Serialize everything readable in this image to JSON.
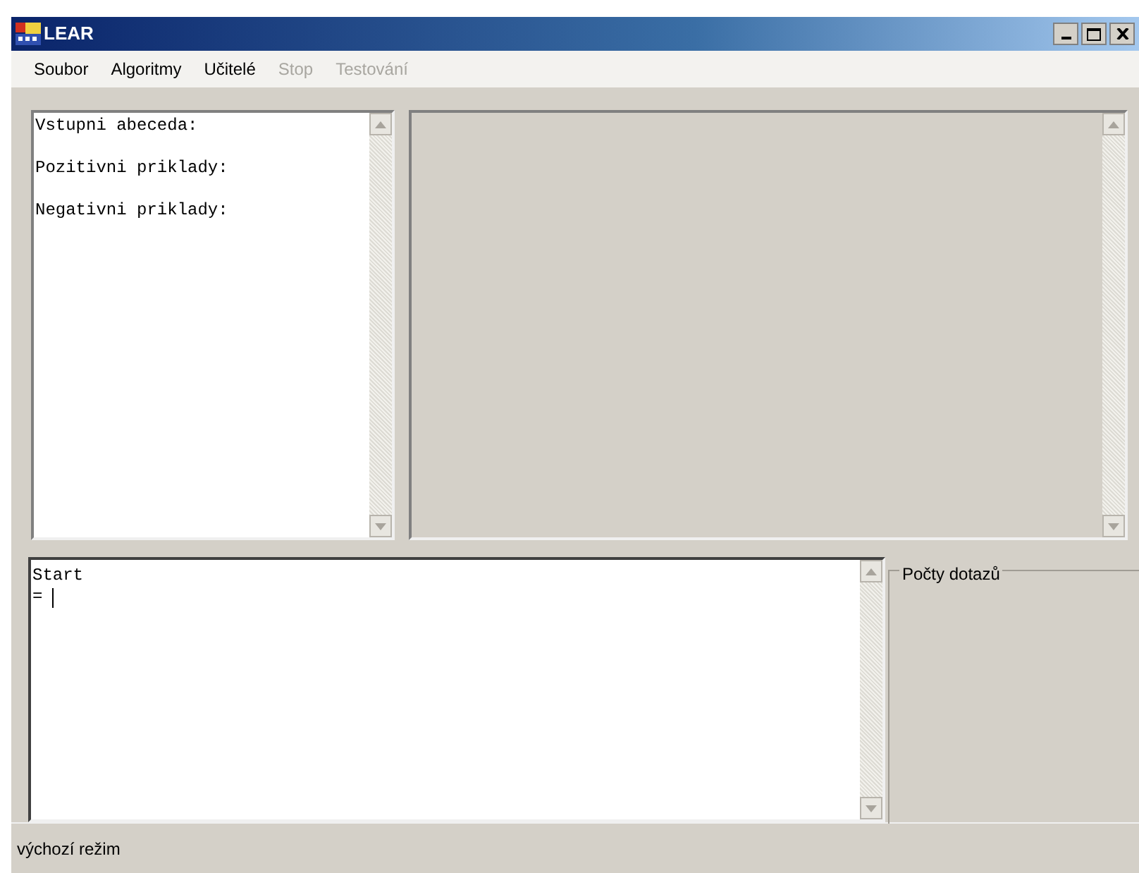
{
  "window": {
    "title": "LEAR"
  },
  "menu": [
    {
      "label": "Soubor",
      "disabled": false
    },
    {
      "label": "Algoritmy",
      "disabled": false
    },
    {
      "label": "Učitelé",
      "disabled": false
    },
    {
      "label": "Stop",
      "disabled": true
    },
    {
      "label": "Testování",
      "disabled": true
    }
  ],
  "input_text": {
    "lines": [
      "Vstupni abeceda:",
      "Pozitivni priklady:",
      "Negativni priklady:"
    ]
  },
  "console": {
    "lines": [
      "Start",
      "= "
    ]
  },
  "query_counts": {
    "title": "Počty dotazů"
  },
  "status_bar": "výchozí režim"
}
